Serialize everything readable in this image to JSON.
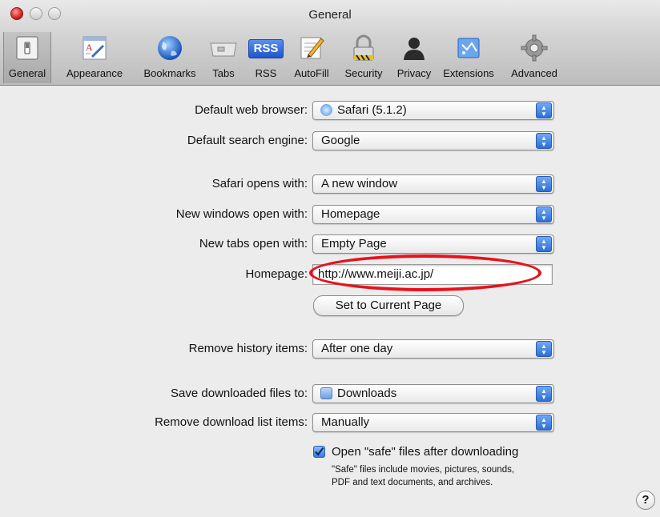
{
  "window": {
    "title": "General"
  },
  "toolbar": {
    "tabs": [
      {
        "label": "General",
        "icon": "general-switch-icon",
        "selected": true
      },
      {
        "label": "Appearance",
        "icon": "appearance-icon"
      },
      {
        "label": "Bookmarks",
        "icon": "globe-icon"
      },
      {
        "label": "Tabs",
        "icon": "tabs-icon"
      },
      {
        "label": "RSS",
        "icon": "rss-icon"
      },
      {
        "label": "AutoFill",
        "icon": "autofill-pencil-icon"
      },
      {
        "label": "Security",
        "icon": "padlock-icon"
      },
      {
        "label": "Privacy",
        "icon": "silhouette-icon"
      },
      {
        "label": "Extensions",
        "icon": "extensions-puzzle-icon"
      },
      {
        "label": "Advanced",
        "icon": "gear-icon"
      }
    ],
    "rss_badge": "RSS"
  },
  "form": {
    "default_browser": {
      "label": "Default web browser:",
      "value": "Safari (5.1.2)"
    },
    "search_engine": {
      "label": "Default search engine:",
      "value": "Google"
    },
    "opens_with": {
      "label": "Safari opens with:",
      "value": "A new window"
    },
    "new_windows": {
      "label": "New windows open with:",
      "value": "Homepage"
    },
    "new_tabs": {
      "label": "New tabs open with:",
      "value": "Empty Page"
    },
    "homepage": {
      "label": "Homepage:",
      "value": "http://www.meiji.ac.jp/"
    },
    "set_current": {
      "label": "Set to Current Page"
    },
    "remove_history": {
      "label": "Remove history items:",
      "value": "After one day"
    },
    "save_downloads": {
      "label": "Save downloaded files to:",
      "value": "Downloads"
    },
    "remove_downloads": {
      "label": "Remove download list items:",
      "value": "Manually"
    },
    "open_safe": {
      "checked": true,
      "label": "Open \"safe\" files after downloading",
      "hint_line1": "\"Safe\" files include movies, pictures, sounds,",
      "hint_line2": "PDF and text documents, and archives."
    }
  },
  "help": {
    "label": "?"
  },
  "colors": {
    "accent": "#2c6fd6",
    "annotation_ring": "#e8111c",
    "window_bg": "#ececec"
  }
}
